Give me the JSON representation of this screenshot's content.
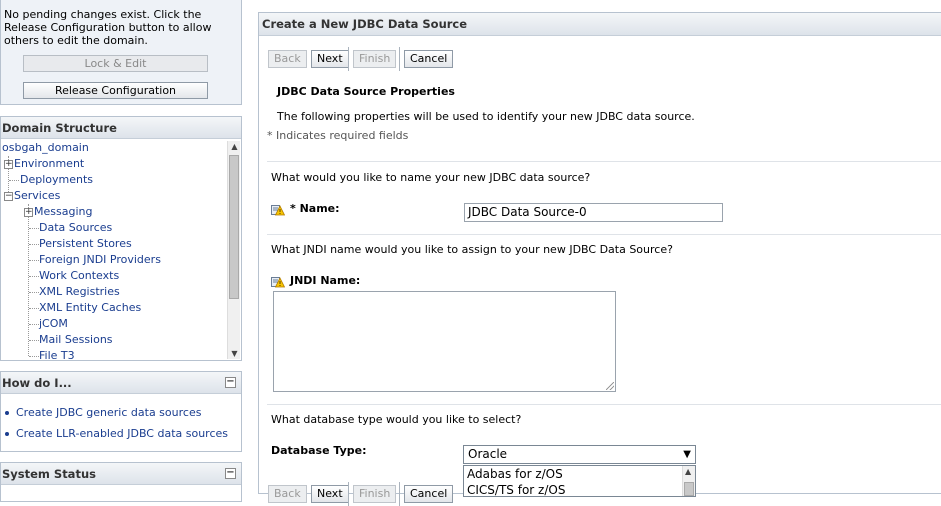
{
  "change_center": {
    "message": "No pending changes exist. Click the Release Configuration button to allow others to edit the domain.",
    "lock_edit_label": "Lock & Edit",
    "release_label": "Release Configuration"
  },
  "domain_structure": {
    "title": "Domain Structure",
    "items": [
      "osbgah_domain",
      "Environment",
      "Deployments",
      "Services",
      "Messaging",
      "Data Sources",
      "Persistent Stores",
      "Foreign JNDI Providers",
      "Work Contexts",
      "XML Registries",
      "XML Entity Caches",
      "jCOM",
      "Mail Sessions",
      "File T3"
    ]
  },
  "how_do_i": {
    "title": "How do I...",
    "links": [
      "Create JDBC generic data sources",
      "Create LLR-enabled JDBC data sources"
    ]
  },
  "system_status": {
    "title": "System Status"
  },
  "main": {
    "title": "Create a New JDBC Data Source",
    "buttons": {
      "back": "Back",
      "next": "Next",
      "finish": "Finish",
      "cancel": "Cancel"
    },
    "section_title": "JDBC Data Source Properties",
    "intro": "The following properties will be used to identify your new JDBC data source.",
    "required_note": "* Indicates required fields",
    "name_question": "What would you like to name your new JDBC data source?",
    "name_label": "* Name:",
    "name_value": "JDBC Data Source-0",
    "jndi_question": "What JNDI name would you like to assign to your new JDBC Data Source?",
    "jndi_label": "JNDI Name:",
    "db_question": "What database type would you like to select?",
    "db_type_label": "Database Type:",
    "db_type_value": "Oracle",
    "db_type_options": [
      "Adabas for z/OS",
      "CICS/TS for z/OS"
    ]
  }
}
